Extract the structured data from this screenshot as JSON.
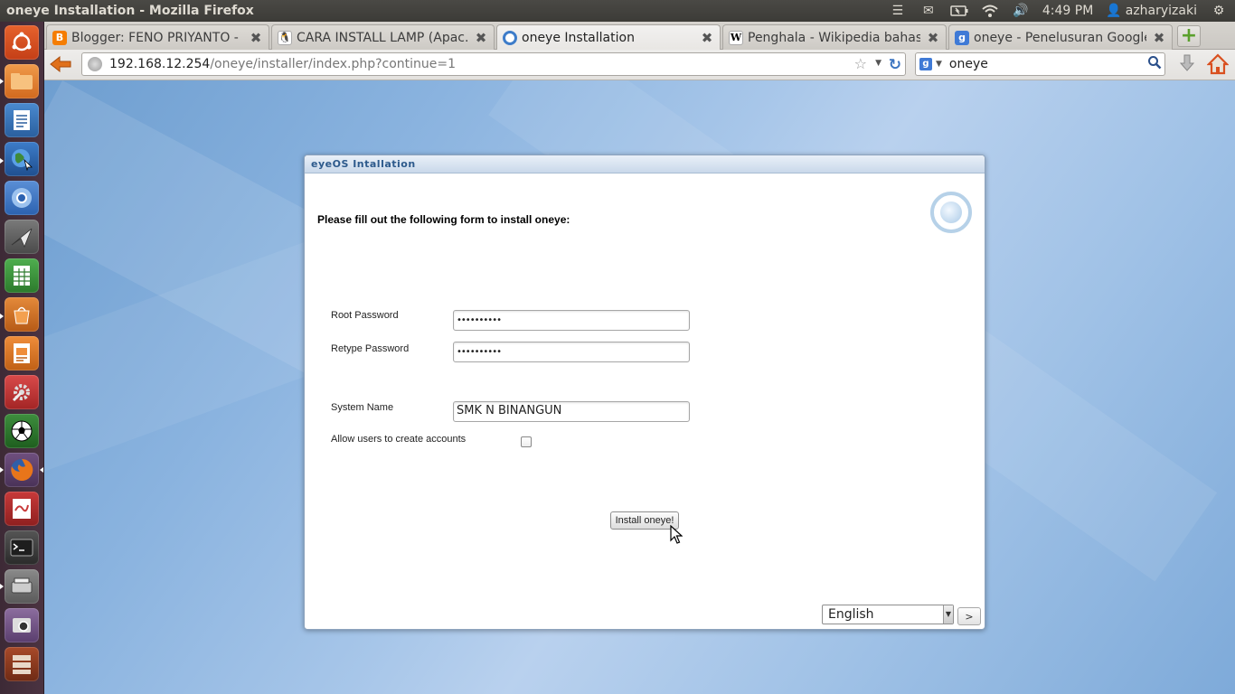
{
  "window": {
    "title": "oneye Installation - Mozilla Firefox"
  },
  "top_panel": {
    "time": "4:49 PM",
    "user": "azharyizaki",
    "icons": [
      "menu-icon",
      "mail-icon",
      "battery-icon",
      "wifi-icon",
      "volume-icon",
      "user-icon",
      "gear-icon"
    ]
  },
  "launcher": {
    "items": [
      "ubuntu-dash-icon",
      "files-icon",
      "libreoffice-writer-icon",
      "browser-globe-icon",
      "chromium-icon",
      "plane-app-icon",
      "libreoffice-calc-icon",
      "software-center-icon",
      "libreoffice-impress-icon",
      "system-settings-icon",
      "soccer-game-icon",
      "firefox-icon",
      "evince-icon",
      "terminal-icon",
      "scanner-icon",
      "webcam-icon",
      "workspaces-icon"
    ]
  },
  "tabs": [
    {
      "title": "Blogger: FENO PRIYANTO - ...",
      "favicon": "blogger-icon",
      "active": false
    },
    {
      "title": "CARA INSTALL LAMP (Apac...",
      "favicon": "tux-icon",
      "active": false
    },
    {
      "title": "oneye Installation",
      "favicon": "oneye-icon",
      "active": true
    },
    {
      "title": "Penghala - Wikipedia bahas...",
      "favicon": "wikipedia-icon",
      "active": false
    },
    {
      "title": "oneye - Penelusuran Google",
      "favicon": "google-icon",
      "active": false
    }
  ],
  "navbar": {
    "url_host": "192.168.12.254",
    "url_path": "/oneye/installer/index.php?continue=1",
    "search_value": "oneye"
  },
  "dialog": {
    "title": "eyeOS Intallation",
    "heading": "Please fill out the following form to install oneye:",
    "root_password_label": "Root Password",
    "root_password_value": "••••••••••",
    "retype_password_label": "Retype Password",
    "retype_password_value": "••••••••••",
    "system_name_label": "System Name",
    "system_name_value": "SMK N BINANGUN",
    "allow_accounts_label": "Allow users to create accounts",
    "allow_accounts_checked": false,
    "install_button": "Install oneye!",
    "language": "English",
    "language_next": ">"
  },
  "colors": {
    "panel_bg": "#3c3b37",
    "launcher_bg": "#4b3341",
    "desktop_blue": "#8ab3df",
    "dialog_title_text": "#2d5a8c",
    "back_arrow": "#e0701a",
    "home_icon": "#d9501f"
  }
}
